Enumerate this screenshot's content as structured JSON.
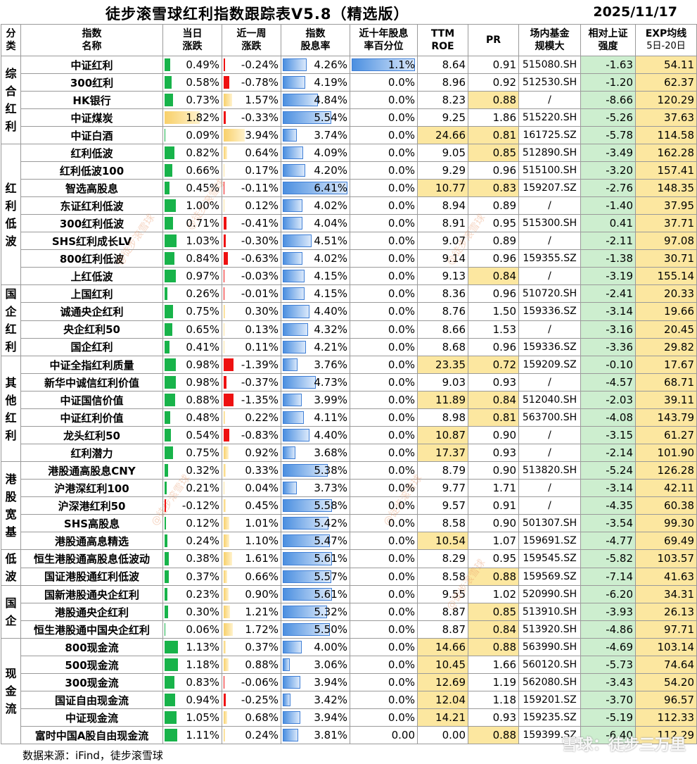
{
  "header": {
    "title": "徒步滚雪球红利指数跟踪表V5.8（精选版）",
    "date": "2025/11/17"
  },
  "columns": {
    "group_l1": "分",
    "group_l2": "类",
    "name_l1": "指数",
    "name_l2": "名称",
    "day_l1": "当日",
    "day_l2": "涨跌",
    "week_l1": "近一周",
    "week_l2": "涨跌",
    "yield_l1": "指数",
    "yield_l2": "股息率",
    "pct_l1": "近十年股息",
    "pct_l2": "率百分位",
    "roe_l1": "TTM",
    "roe_l2": "ROE",
    "pr": "PR",
    "fund_l1": "场内基金",
    "fund_l2": "规模大",
    "rel_l1": "相对上证",
    "rel_l2": "强度",
    "exp_l1": "EXP均线",
    "exp_l2": "5日-20日"
  },
  "groups": [
    {
      "label": "综合红利",
      "start": 0,
      "span": 5
    },
    {
      "label": "红利低波",
      "start": 5,
      "span": 8
    },
    {
      "label": "国企红利",
      "start": 13,
      "span": 4
    },
    {
      "label": "其他红利",
      "start": 17,
      "span": 6
    },
    {
      "label": "港股宽基",
      "start": 23,
      "span": 5
    },
    {
      "label": "低波",
      "start": 28,
      "span": 2
    },
    {
      "label": "国企",
      "start": 30,
      "span": 3
    },
    {
      "label": "现金流",
      "start": 33,
      "span": 6
    }
  ],
  "rows": [
    {
      "name": "中证红利",
      "day": "0.49%",
      "week": "-0.24%",
      "yield": "4.26%",
      "pct": "1.1%",
      "roe": "8.64",
      "pr": "0.91",
      "fund": "515080.SH",
      "rel": "-1.63",
      "exp": "54.11"
    },
    {
      "name": "300红利",
      "day": "0.58%",
      "week": "-0.78%",
      "yield": "4.19%",
      "pct": "0.0%",
      "roe": "8.96",
      "pr": "0.92",
      "fund": "512530.SH",
      "rel": "-1.20",
      "exp": "62.37"
    },
    {
      "name": "HK银行",
      "day": "0.73%",
      "week": "1.57%",
      "yield": "4.84%",
      "pct": "0.0%",
      "roe": "8.23",
      "pr": "0.88",
      "fund": "/",
      "rel": "-8.66",
      "exp": "120.29"
    },
    {
      "name": "中证煤炭",
      "day": "1.82%",
      "week": "-0.33%",
      "yield": "5.54%",
      "pct": "0.0%",
      "roe": "9.25",
      "pr": "1.86",
      "fund": "515220.SH",
      "rel": "-5.26",
      "exp": "37.63"
    },
    {
      "name": "中证白酒",
      "day": "0.09%",
      "week": "3.94%",
      "yield": "3.74%",
      "pct": "0.0%",
      "roe": "24.66",
      "pr": "0.81",
      "fund": "161725.SZ",
      "rel": "-5.78",
      "exp": "114.58"
    },
    {
      "name": "红利低波",
      "day": "0.82%",
      "week": "0.64%",
      "yield": "4.09%",
      "pct": "0.0%",
      "roe": "9.05",
      "pr": "0.85",
      "fund": "512890.SH",
      "rel": "-3.49",
      "exp": "162.28"
    },
    {
      "name": "红利低波100",
      "day": "0.66%",
      "week": "0.17%",
      "yield": "4.20%",
      "pct": "0.0%",
      "roe": "9.29",
      "pr": "0.96",
      "fund": "515100.SH",
      "rel": "-3.20",
      "exp": "157.41"
    },
    {
      "name": "智选高股息",
      "day": "0.45%",
      "week": "-0.11%",
      "yield": "6.41%",
      "pct": "0.0%",
      "roe": "10.77",
      "pr": "0.83",
      "fund": "159207.SZ",
      "rel": "-2.76",
      "exp": "148.35"
    },
    {
      "name": "东证红利低波",
      "day": "1.00%",
      "week": "0.12%",
      "yield": "4.02%",
      "pct": "0.0%",
      "roe": "8.94",
      "pr": "0.89",
      "fund": "/",
      "rel": "-1.40",
      "exp": "37.95"
    },
    {
      "name": "300红利低波",
      "day": "0.71%",
      "week": "-0.41%",
      "yield": "4.04%",
      "pct": "0.0%",
      "roe": "8.91",
      "pr": "0.95",
      "fund": "515300.SH",
      "rel": "0.41",
      "exp": "37.71"
    },
    {
      "name": "SHS红利成长LV",
      "day": "1.03%",
      "week": "-0.30%",
      "yield": "4.51%",
      "pct": "0.0%",
      "roe": "9.07",
      "pr": "0.89",
      "fund": "/",
      "rel": "-2.11",
      "exp": "97.08"
    },
    {
      "name": "800红利低波",
      "day": "0.84%",
      "week": "-0.63%",
      "yield": "4.02%",
      "pct": "0.0%",
      "roe": "9.14",
      "pr": "0.96",
      "fund": "159355.SZ",
      "rel": "-1.38",
      "exp": "30.71"
    },
    {
      "name": "上红低波",
      "day": "0.97%",
      "week": "-0.03%",
      "yield": "4.15%",
      "pct": "0.0%",
      "roe": "9.13",
      "pr": "0.84",
      "fund": "/",
      "rel": "-3.19",
      "exp": "155.14"
    },
    {
      "name": "上国红利",
      "day": "0.26%",
      "week": "-0.01%",
      "yield": "4.15%",
      "pct": "0.0%",
      "roe": "8.36",
      "pr": "0.96",
      "fund": "510720.SH",
      "rel": "-2.41",
      "exp": "20.33"
    },
    {
      "name": "诚通央企红利",
      "day": "0.75%",
      "week": "0.30%",
      "yield": "4.40%",
      "pct": "0.0%",
      "roe": "8.76",
      "pr": "1.50",
      "fund": "159336.SZ",
      "rel": "-3.14",
      "exp": "19.66"
    },
    {
      "name": "央企红利50",
      "day": "0.65%",
      "week": "0.13%",
      "yield": "4.32%",
      "pct": "0.0%",
      "roe": "8.66",
      "pr": "1.53",
      "fund": "/",
      "rel": "-3.16",
      "exp": "20.45"
    },
    {
      "name": "国企红利",
      "day": "0.41%",
      "week": "0.11%",
      "yield": "4.21%",
      "pct": "0.0%",
      "roe": "8.68",
      "pr": "0.96",
      "fund": "159336.SZ",
      "rel": "-3.36",
      "exp": "29.82"
    },
    {
      "name": "中证全指红利质量",
      "day": "0.98%",
      "week": "-1.39%",
      "yield": "3.76%",
      "pct": "0.0%",
      "roe": "23.35",
      "pr": "0.72",
      "fund": "159209.SZ",
      "rel": "-0.10",
      "exp": "17.67"
    },
    {
      "name": "新华中诚信红利价值",
      "day": "0.98%",
      "week": "-0.37%",
      "yield": "4.73%",
      "pct": "0.0%",
      "roe": "9.03",
      "pr": "0.93",
      "fund": "/",
      "rel": "-4.57",
      "exp": "68.71"
    },
    {
      "name": "中证国信价值",
      "day": "0.88%",
      "week": "-1.35%",
      "yield": "3.99%",
      "pct": "0.0%",
      "roe": "11.89",
      "pr": "0.84",
      "fund": "512040.SH",
      "rel": "-2.03",
      "exp": "39.11"
    },
    {
      "name": "中证红利价值",
      "day": "0.48%",
      "week": "0.22%",
      "yield": "4.11%",
      "pct": "0.0%",
      "roe": "8.98",
      "pr": "0.81",
      "fund": "563700.SH",
      "rel": "-4.08",
      "exp": "143.79"
    },
    {
      "name": "龙头红利50",
      "day": "0.54%",
      "week": "-0.83%",
      "yield": "4.40%",
      "pct": "0.0%",
      "roe": "10.87",
      "pr": "0.90",
      "fund": "/",
      "rel": "-3.15",
      "exp": "61.27"
    },
    {
      "name": "红利潜力",
      "day": "0.75%",
      "week": "0.92%",
      "yield": "3.68%",
      "pct": "0.0%",
      "roe": "17.37",
      "pr": "0.93",
      "fund": "/",
      "rel": "-2.14",
      "exp": "101.90"
    },
    {
      "name": "港股通高股息CNY",
      "day": "0.32%",
      "week": "0.33%",
      "yield": "5.38%",
      "pct": "0.0%",
      "roe": "8.79",
      "pr": "0.90",
      "fund": "513820.SH",
      "rel": "-5.24",
      "exp": "126.28"
    },
    {
      "name": "沪港深红利100",
      "day": "0.21%",
      "week": "0.04%",
      "yield": "3.73%",
      "pct": "0.0%",
      "roe": "9.77",
      "pr": "1.71",
      "fund": "/",
      "rel": "-3.14",
      "exp": "42.11"
    },
    {
      "name": "沪深港红利50",
      "day": "-0.12%",
      "week": "0.45%",
      "yield": "5.58%",
      "pct": "0.0%",
      "roe": "9.57",
      "pr": "0.91",
      "fund": "/",
      "rel": "-4.35",
      "exp": "60.38"
    },
    {
      "name": "SHS高股息",
      "day": "0.12%",
      "week": "1.01%",
      "yield": "5.42%",
      "pct": "0.0%",
      "roe": "8.58",
      "pr": "0.90",
      "fund": "501307.SH",
      "rel": "-3.54",
      "exp": "99.30"
    },
    {
      "name": "港股通高息精选",
      "day": "0.24%",
      "week": "1.10%",
      "yield": "5.47%",
      "pct": "0.0%",
      "roe": "10.54",
      "pr": "1.07",
      "fund": "159691.SZ",
      "rel": "-4.77",
      "exp": "69.49"
    },
    {
      "name": "恒生港股通高股息低波动",
      "day": "0.38%",
      "week": "1.61%",
      "yield": "5.61%",
      "pct": "0.0%",
      "roe": "8.29",
      "pr": "0.95",
      "fund": "159545.SZ",
      "rel": "-5.82",
      "exp": "103.57"
    },
    {
      "name": "国证港股通红利低波",
      "day": "0.37%",
      "week": "0.66%",
      "yield": "5.57%",
      "pct": "0.0%",
      "roe": "8.58",
      "pr": "0.88",
      "fund": "159569.SZ",
      "rel": "-7.14",
      "exp": "41.63"
    },
    {
      "name": "国新港股通央企红利",
      "day": "0.23%",
      "week": "0.90%",
      "yield": "5.61%",
      "pct": "0.0%",
      "roe": "9.55",
      "pr": "1.02",
      "fund": "520990.SH",
      "rel": "-6.20",
      "exp": "34.31"
    },
    {
      "name": "港股通央企红利",
      "day": "0.30%",
      "week": "1.21%",
      "yield": "5.32%",
      "pct": "0.0%",
      "roe": "8.87",
      "pr": "0.85",
      "fund": "513910.SH",
      "rel": "-3.93",
      "exp": "26.13"
    },
    {
      "name": "恒生港股通中国央企红利",
      "day": "0.06%",
      "week": "1.72%",
      "yield": "5.50%",
      "pct": "0.0%",
      "roe": "8.87",
      "pr": "0.84",
      "fund": "513920.SH",
      "rel": "-4.86",
      "exp": "97.71"
    },
    {
      "name": "800现金流",
      "day": "1.13%",
      "week": "0.37%",
      "yield": "4.00%",
      "pct": "0.0%",
      "roe": "14.66",
      "pr": "0.88",
      "fund": "563990.SH",
      "rel": "-4.69",
      "exp": "103.14"
    },
    {
      "name": "500现金流",
      "day": "1.18%",
      "week": "0.88%",
      "yield": "3.06%",
      "pct": "0.0%",
      "roe": "10.45",
      "pr": "1.66",
      "fund": "560120.SH",
      "rel": "-5.73",
      "exp": "74.64"
    },
    {
      "name": "300现金流",
      "day": "0.83%",
      "week": "-0.06%",
      "yield": "3.94%",
      "pct": "0.0%",
      "roe": "12.69",
      "pr": "1.19",
      "fund": "562080.SH",
      "rel": "-3.43",
      "exp": "54.20"
    },
    {
      "name": "国证自由现金流",
      "day": "0.94%",
      "week": "-0.25%",
      "yield": "3.42%",
      "pct": "0.0%",
      "roe": "12.04",
      "pr": "1.18",
      "fund": "159201.SZ",
      "rel": "-3.70",
      "exp": "96.57"
    },
    {
      "name": "中证现金流",
      "day": "1.05%",
      "week": "0.68%",
      "yield": "3.94%",
      "pct": "0.0%",
      "roe": "14.21",
      "pr": "0.93",
      "fund": "159235.SZ",
      "rel": "-5.19",
      "exp": "112.33"
    },
    {
      "name": "富时中国A股自由现金流",
      "day": "1.11%",
      "week": "0.24%",
      "yield": "3.81%",
      "pct": "0.00",
      "roe": "0.00",
      "pr": "0.88",
      "fund": "159399.SZ",
      "rel": "-6.40",
      "exp": "112.29"
    }
  ],
  "footer": {
    "source": "数据来源：iFind，徒步滚雪球"
  },
  "watermark": {
    "text": "@徒步滚雪球",
    "logo": "雪球：徒步三万里"
  },
  "colors": {
    "up_bar": "#18b34a",
    "down_bar": "#ee1111",
    "week_up_bar": "#f8d06a",
    "yield_bar": "#4b8fe0",
    "highlight_yellow": "#fce7a0",
    "relative_green": "#cdeecf"
  }
}
